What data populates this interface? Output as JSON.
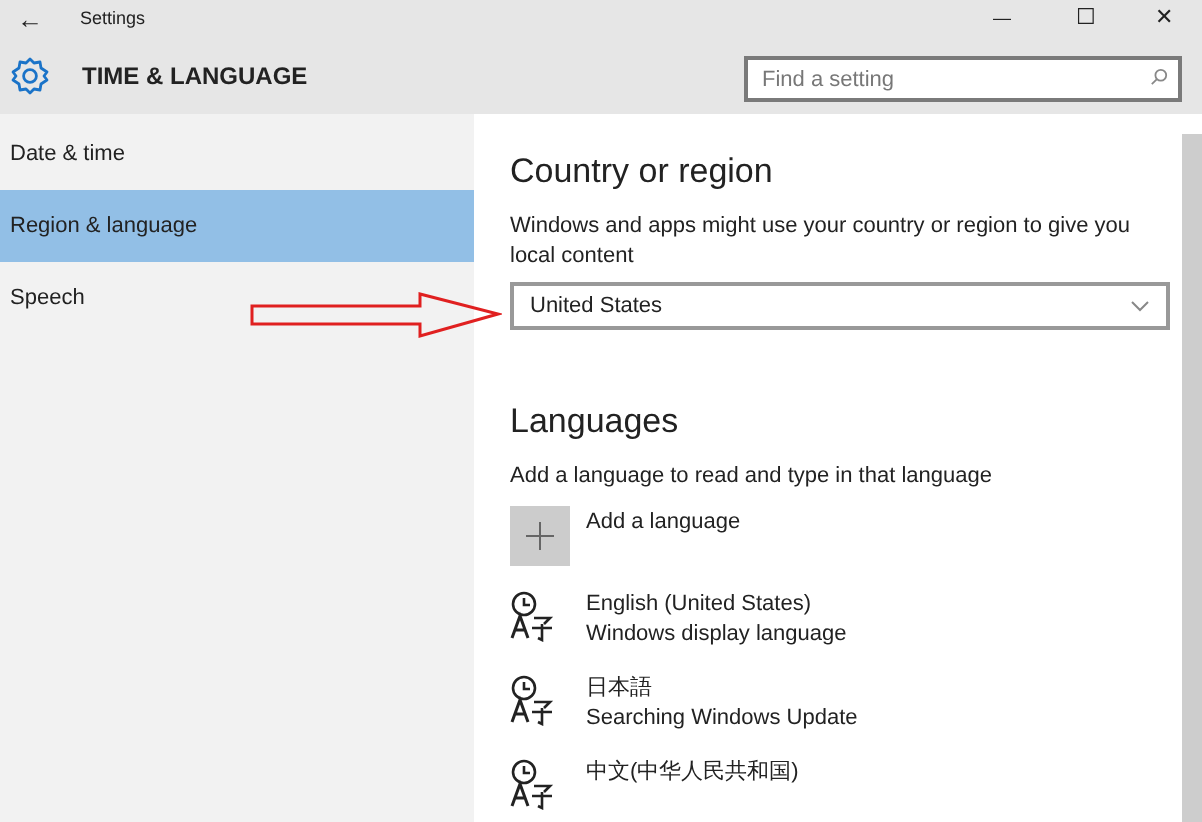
{
  "window": {
    "title": "Settings",
    "back": "←",
    "minimize": "—",
    "maximize": "☐",
    "close": "✕"
  },
  "header": {
    "title": "TIME & LANGUAGE"
  },
  "search": {
    "placeholder": "Find a setting"
  },
  "sidebar": {
    "items": [
      {
        "label": "Date & time",
        "selected": false
      },
      {
        "label": "Region & language",
        "selected": true
      },
      {
        "label": "Speech",
        "selected": false
      }
    ]
  },
  "country": {
    "heading": "Country or region",
    "description": "Windows and apps might use your country or region to give you local content",
    "value": "United States"
  },
  "languages": {
    "heading": "Languages",
    "description": "Add a language to read and type in that language",
    "add_label": "Add a language",
    "items": [
      {
        "name": "English (United States)",
        "status": "Windows display language"
      },
      {
        "name": "日本語",
        "status": "Searching Windows Update"
      },
      {
        "name": "中文(中华人民共和国)"
      }
    ]
  }
}
